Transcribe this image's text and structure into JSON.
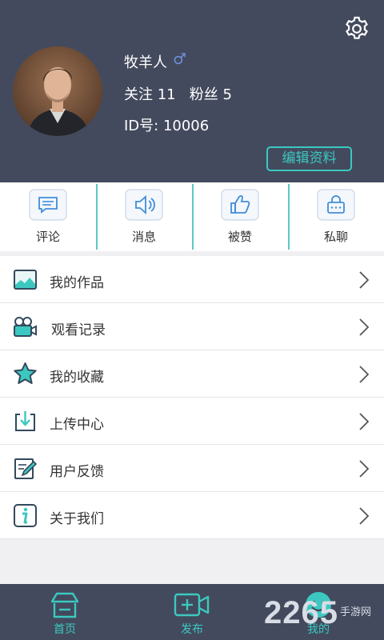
{
  "profile": {
    "username": "牧羊人",
    "gender_symbol": "♂",
    "follows": "关注 11   粉丝 5",
    "id_text": "ID号: 10006",
    "edit_label": "编辑资料"
  },
  "quick_actions": [
    {
      "label": "评论",
      "icon": "comment-icon"
    },
    {
      "label": "消息",
      "icon": "speaker-icon"
    },
    {
      "label": "被赞",
      "icon": "thumbs-up-icon"
    },
    {
      "label": "私聊",
      "icon": "lock-chat-icon"
    }
  ],
  "menu": [
    {
      "label": "我的作品",
      "icon": "image-icon"
    },
    {
      "label": "观看记录",
      "icon": "video-camera-icon"
    },
    {
      "label": "我的收藏",
      "icon": "star-icon"
    },
    {
      "label": "上传中心",
      "icon": "download-tray-icon"
    },
    {
      "label": "用户反馈",
      "icon": "edit-note-icon"
    },
    {
      "label": "关于我们",
      "icon": "info-icon"
    }
  ],
  "tabbar": [
    {
      "label": "首页",
      "icon": "home-icon"
    },
    {
      "label": "发布",
      "icon": "add-video-icon"
    },
    {
      "label": "我的",
      "icon": "smile-face-icon",
      "active": true
    }
  ],
  "watermark": {
    "brand": "2265",
    "site": "手游网"
  },
  "colors": {
    "header_bg": "#434a5d",
    "accent": "#3cc8c0",
    "background": "#f0f0f2"
  }
}
